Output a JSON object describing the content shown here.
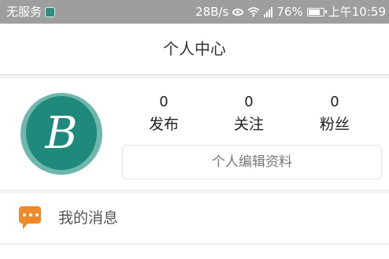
{
  "status_bar": {
    "carrier": "无服务",
    "speed": "28B/s",
    "battery": "76%",
    "time": "上午10:59"
  },
  "header": {
    "title": "个人中心"
  },
  "profile": {
    "avatar_letter": "B",
    "stats": [
      {
        "value": "0",
        "label": "发布"
      },
      {
        "value": "0",
        "label": "关注"
      },
      {
        "value": "0",
        "label": "粉丝"
      }
    ],
    "edit_label": "个人编辑资料"
  },
  "menu": {
    "messages_label": "我的消息"
  },
  "colors": {
    "status_bar": "#9e9e9e",
    "avatar": "#1f8a7b",
    "message_icon": "#ee8a2c"
  },
  "icons": [
    "app-icon",
    "eye-icon",
    "wifi-icon",
    "signal-icon",
    "battery-icon",
    "message-icon"
  ]
}
